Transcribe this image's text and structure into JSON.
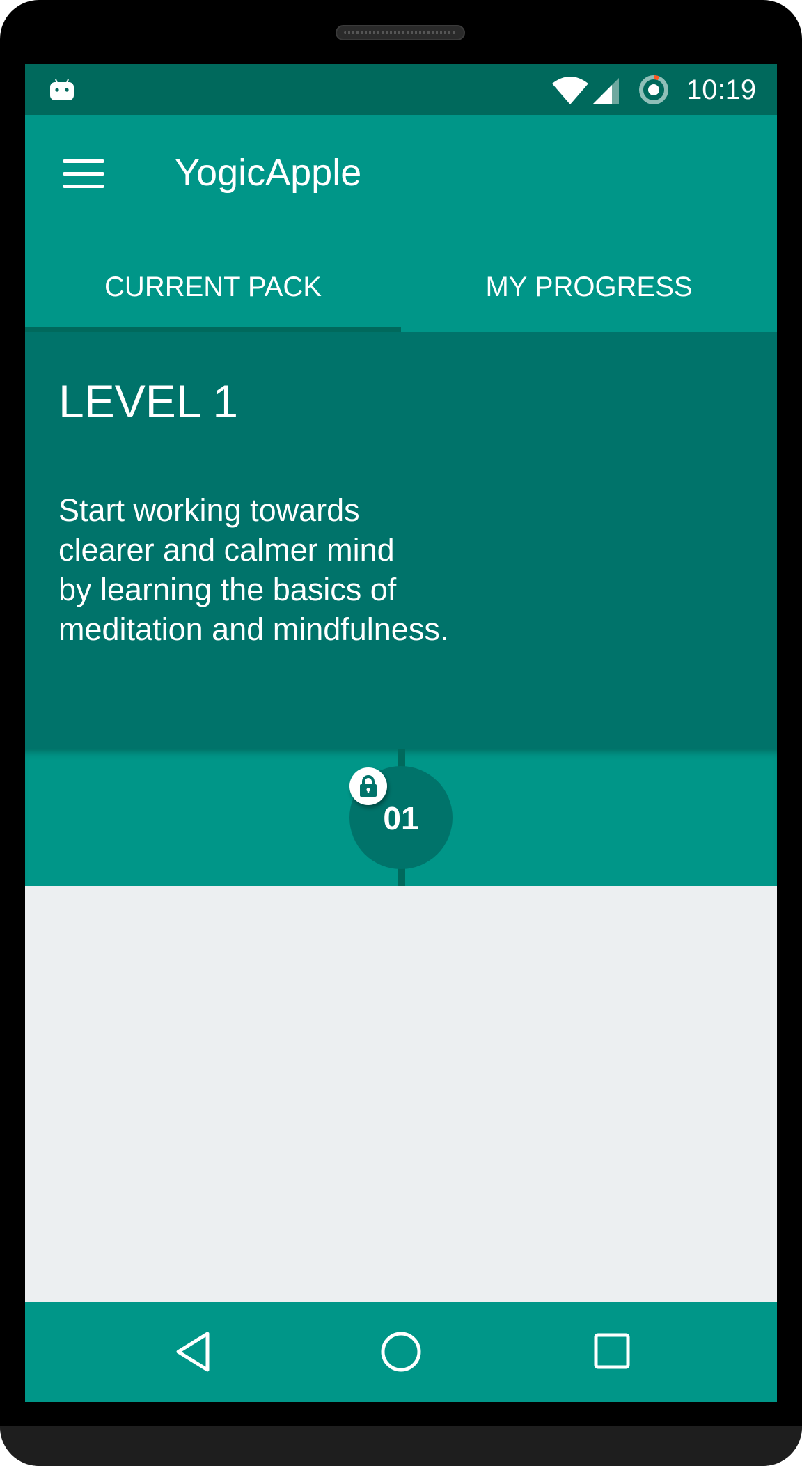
{
  "status_bar": {
    "time": "10:19",
    "icons": [
      "android-icon",
      "wifi-icon",
      "signal-icon",
      "sync-icon"
    ]
  },
  "app_bar": {
    "title": "YogicApple",
    "menu_icon": "menu-icon"
  },
  "tabs": [
    {
      "label": "CURRENT PACK",
      "selected": true
    },
    {
      "label": "MY PROGRESS",
      "selected": false
    }
  ],
  "level": {
    "title": "LEVEL 1",
    "description_lines": [
      "Start working towards",
      "clearer and calmer mind",
      "by learning the basics of",
      "meditation and mindfulness."
    ]
  },
  "lessons": [
    {
      "number": "01",
      "locked": true,
      "badge_icon": "lock-icon"
    }
  ],
  "nav_bar": {
    "buttons": [
      "back-icon",
      "home-icon",
      "recents-icon"
    ]
  },
  "colors": {
    "status_bar": "#00695c",
    "primary": "#009688",
    "primary_dark": "#00736a",
    "background": "#eceff1",
    "text_on_primary": "#ffffff"
  }
}
